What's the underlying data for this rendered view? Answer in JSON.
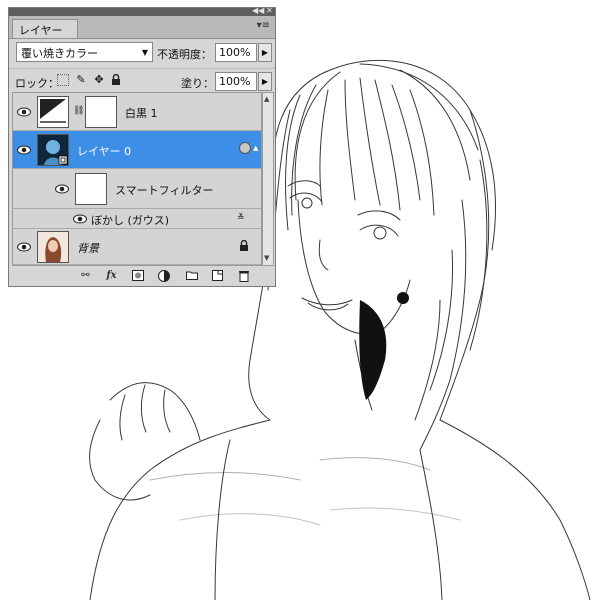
{
  "panel": {
    "tab_label": "レイヤー",
    "blend_mode": "覆い焼きカラー",
    "opacity_label": "不透明度：",
    "opacity_value": "100%",
    "lock_label": "ロック：",
    "fill_label": "塗り：",
    "fill_value": "100%"
  },
  "layers": [
    {
      "name": "白黒 1",
      "type": "adjustment",
      "visible": true,
      "selected": false
    },
    {
      "name": "レイヤー 0",
      "type": "smart-object",
      "visible": true,
      "selected": true
    },
    {
      "name": "スマートフィルター",
      "type": "smart-filter-group",
      "visible": true,
      "selected": false
    },
    {
      "name": "ぼかし (ガウス)",
      "type": "filter",
      "visible": true,
      "selected": false
    },
    {
      "name": "背景",
      "type": "background",
      "visible": true,
      "locked": true,
      "selected": false
    }
  ],
  "colors": {
    "selection": "#3d8ee6",
    "panel_bg": "#d6d6d6"
  },
  "bottom_icons": [
    "link-icon",
    "fx-icon",
    "mask-icon",
    "adjustment-icon",
    "folder-icon",
    "new-layer-icon",
    "trash-icon"
  ]
}
